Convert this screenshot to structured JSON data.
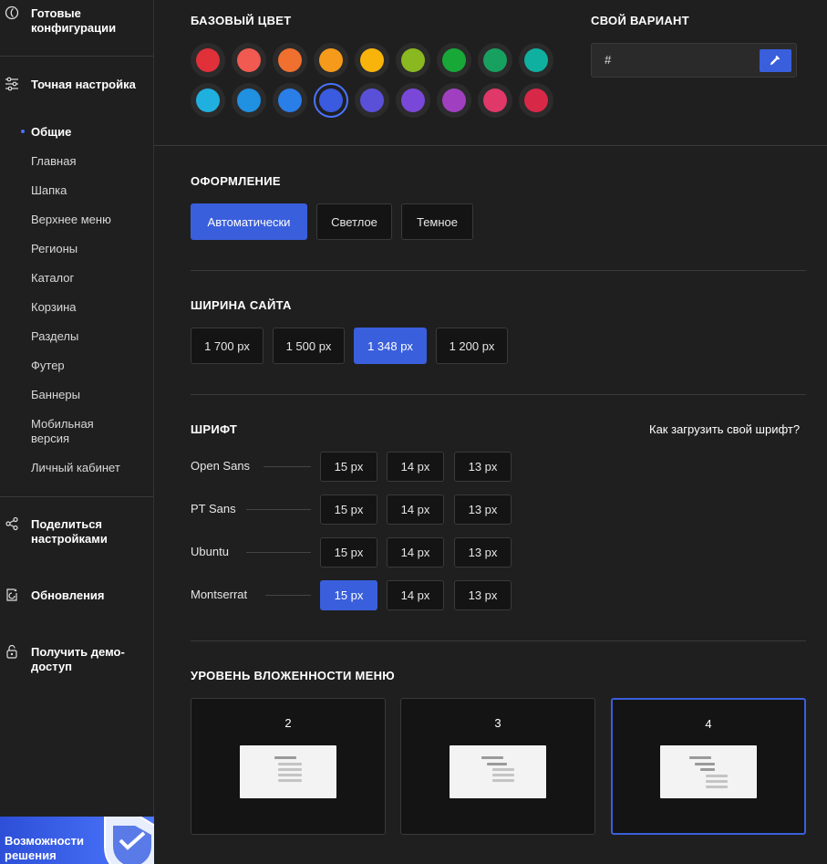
{
  "sidebar": {
    "ready_configs": "Готовые конфигурации",
    "fine_tuning": "Точная настройка",
    "sub_items": [
      "Общие",
      "Главная",
      "Шапка",
      "Верхнее меню",
      "Регионы",
      "Каталог",
      "Корзина",
      "Разделы",
      "Футер",
      "Баннеры",
      "Мобильная версия",
      "Личный кабинет"
    ],
    "active_sub": "Общие",
    "share": "Поделиться настройками",
    "updates": "Обновления",
    "demo": "Получить демо-доступ",
    "promo": "Возможности решения"
  },
  "base_color": {
    "heading": "БАЗОВЫЙ ЦВЕТ",
    "swatches": [
      "#e0303a",
      "#f05a50",
      "#f07030",
      "#f59a1a",
      "#f8b40a",
      "#8ab820",
      "#18a838",
      "#18a060",
      "#10b0a0",
      "#20b0e0",
      "#2090e0",
      "#2a7ee8",
      "#3a5ae0",
      "#5a50d8",
      "#7a48d8",
      "#a040c0",
      "#e03868",
      "#d82848"
    ],
    "selected_index": 12
  },
  "custom_color": {
    "heading": "СВОЙ ВАРИАНТ",
    "value": "#",
    "picker_icon": "eyedropper-icon"
  },
  "appearance": {
    "heading": "ОФОРМЛЕНИЕ",
    "options": [
      "Автоматически",
      "Светлое",
      "Темное"
    ],
    "selected": "Автоматически"
  },
  "site_width": {
    "heading": "ШИРИНА САЙТА",
    "options": [
      "1 700 px",
      "1 500 px",
      "1 348 px",
      "1 200 px"
    ],
    "selected": "1 348 px"
  },
  "font": {
    "heading": "ШРИФТ",
    "upload_link": "Как загрузить свой шрифт?",
    "families": [
      {
        "name": "Open Sans",
        "sizes": [
          "15 px",
          "14 px",
          "13 px"
        ]
      },
      {
        "name": "PT Sans",
        "sizes": [
          "15 px",
          "14 px",
          "13 px"
        ]
      },
      {
        "name": "Ubuntu",
        "sizes": [
          "15 px",
          "14 px",
          "13 px"
        ]
      },
      {
        "name": "Montserrat",
        "sizes": [
          "15 px",
          "14 px",
          "13 px"
        ]
      }
    ],
    "selected_family": "Montserrat",
    "selected_size": "15 px"
  },
  "menu_level": {
    "heading": "УРОВЕНЬ ВЛОЖЕННОСТИ МЕНЮ",
    "options": [
      "2",
      "3",
      "4"
    ],
    "selected": "4"
  },
  "colors": {
    "accent": "#3a5fdc",
    "background": "#1f1f1f",
    "panel": "#141414"
  }
}
